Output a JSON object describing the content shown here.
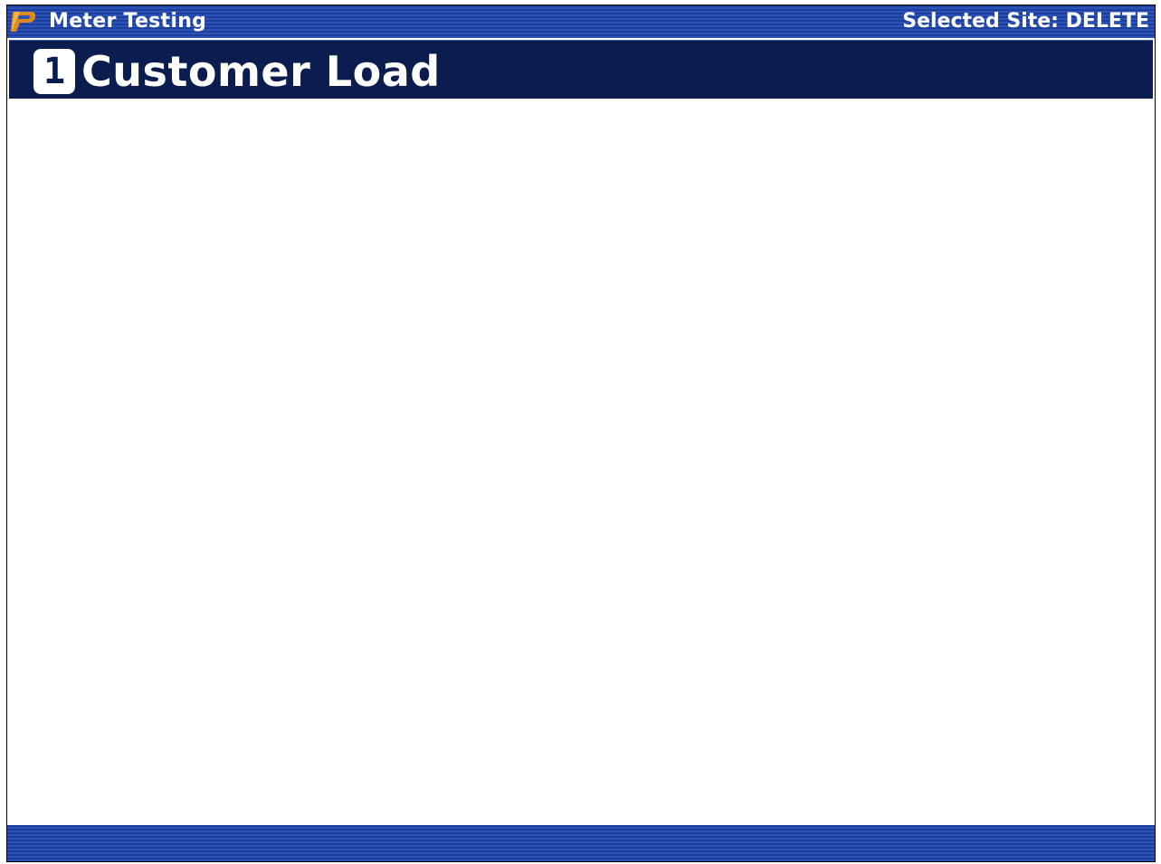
{
  "titlebar": {
    "app_title": "Meter Testing",
    "site_label": "Selected Site: DELETE",
    "logo_icon": "p-logo-icon"
  },
  "header": {
    "step_number": "1",
    "page_title": "Customer Load"
  },
  "colors": {
    "titlebar_blue": "#2b53b8",
    "header_navy": "#0b1d4f",
    "logo_orange": "#e08a1e"
  }
}
